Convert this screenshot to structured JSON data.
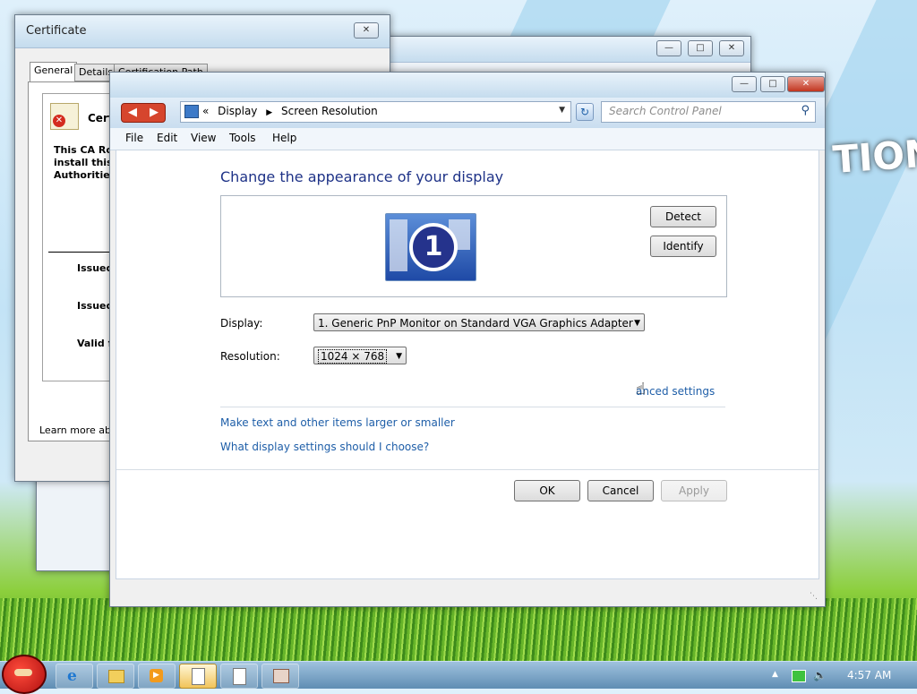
{
  "certificate_window": {
    "title": "Certificate",
    "tabs": [
      "General",
      "Details",
      "Certification Path"
    ],
    "cert_heading": "Cert",
    "body_lines": [
      "This CA Roo",
      "install this c",
      "Authorities"
    ],
    "issued_to": "Issued",
    "issued_by": "Issued",
    "valid_from": "Valid fr",
    "learn_more": "Learn more abou"
  },
  "display_window": {
    "breadcrumb_root": "Display",
    "breadcrumb_page": "Screen Resolution",
    "search_placeholder": "Search Control Panel",
    "menu": [
      "File",
      "Edit",
      "View",
      "Tools",
      "Help"
    ],
    "heading": "Change the appearance of your display",
    "detect_label": "Detect",
    "identify_label": "Identify",
    "monitor_number": "1",
    "display_label": "Display:",
    "display_value": "1. Generic PnP Monitor on Standard VGA Graphics Adapter",
    "resolution_label": "Resolution:",
    "resolution_value": "1024 × 768",
    "advanced_link": "anced settings",
    "link_text_size": "Make text and other items larger or smaller",
    "link_help": "What display settings should I choose?",
    "ok_label": "OK",
    "cancel_label": "Cancel",
    "apply_label": "Apply"
  },
  "desktop": {
    "wallpaper_text": "TION"
  },
  "taskbar": {
    "clock": "4:57 AM"
  },
  "colors": {
    "heading": "#1e3287",
    "link": "#1e5ea8",
    "close_button": "#c2351f"
  }
}
